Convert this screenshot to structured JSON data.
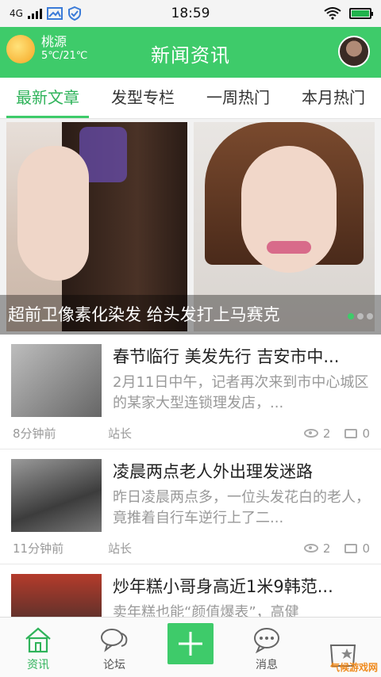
{
  "status_bar": {
    "network": "4G",
    "time": "18:59",
    "battery_level": 1.0
  },
  "header": {
    "title": "新闻资讯",
    "weather": {
      "city": "桃源",
      "temperature": "5℃/21℃",
      "icon": "sun-icon"
    }
  },
  "tabs": [
    {
      "label": "最新文章",
      "active": true
    },
    {
      "label": "发型专栏",
      "active": false
    },
    {
      "label": "一周热门",
      "active": false
    },
    {
      "label": "本月热门",
      "active": false
    }
  ],
  "banner": {
    "caption": "超前卫像素化染发 给头发打上马赛克",
    "active_index": 0,
    "total": 3
  },
  "news": [
    {
      "title": "春节临行 美发先行 吉安市中...",
      "summary": "2月11日中午，记者再次来到市中心城区的某家大型连锁理发店，...",
      "time": "8分钟前",
      "author": "站长",
      "views": "2",
      "comments": "0"
    },
    {
      "title": "凌晨两点老人外出理发迷路",
      "summary": "昨日凌晨两点多，一位头发花白的老人，竟推着自行车逆行上了二...",
      "time": "11分钟前",
      "author": "站长",
      "views": "2",
      "comments": "0"
    },
    {
      "title": "炒年糕小哥身高近1米9韩范...",
      "summary": "卖年糕也能“颜值爆表”，高健",
      "time": "",
      "author": "",
      "views": "",
      "comments": ""
    }
  ],
  "bottom_nav": {
    "items": [
      {
        "label": "资讯",
        "icon": "home-icon",
        "active": true
      },
      {
        "label": "论坛",
        "icon": "chat-bubbles-icon",
        "active": false
      },
      {
        "label": "",
        "icon": "plus-icon",
        "active": false
      },
      {
        "label": "消息",
        "icon": "message-icon",
        "active": false
      },
      {
        "label": "",
        "icon": "profile-card-icon",
        "active": false
      }
    ]
  },
  "watermark": "气候游戏网",
  "colors": {
    "accent": "#3ecb6a",
    "accent_text": "#2fb35a",
    "muted": "#999999"
  }
}
